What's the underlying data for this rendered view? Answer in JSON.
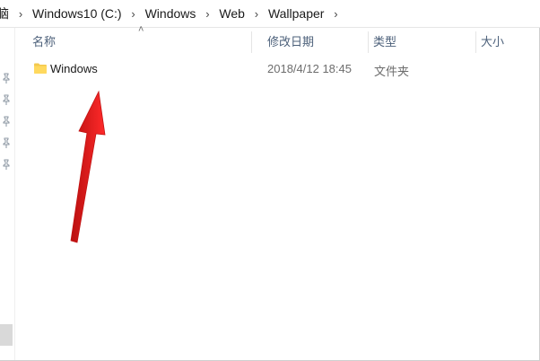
{
  "breadcrumb": {
    "partial": "脑",
    "items": [
      "Windows10 (C:)",
      "Windows",
      "Web",
      "Wallpaper"
    ]
  },
  "columns": {
    "name": "名称",
    "modified": "修改日期",
    "type": "类型",
    "size": "大小"
  },
  "files": [
    {
      "name": "Windows",
      "modified": "2018/4/12 18:45",
      "type": "文件夹",
      "size": ""
    }
  ],
  "colors": {
    "accent_arrow": "#e11d1d",
    "header_text": "#4c607a",
    "folder": "#f3c94e"
  }
}
